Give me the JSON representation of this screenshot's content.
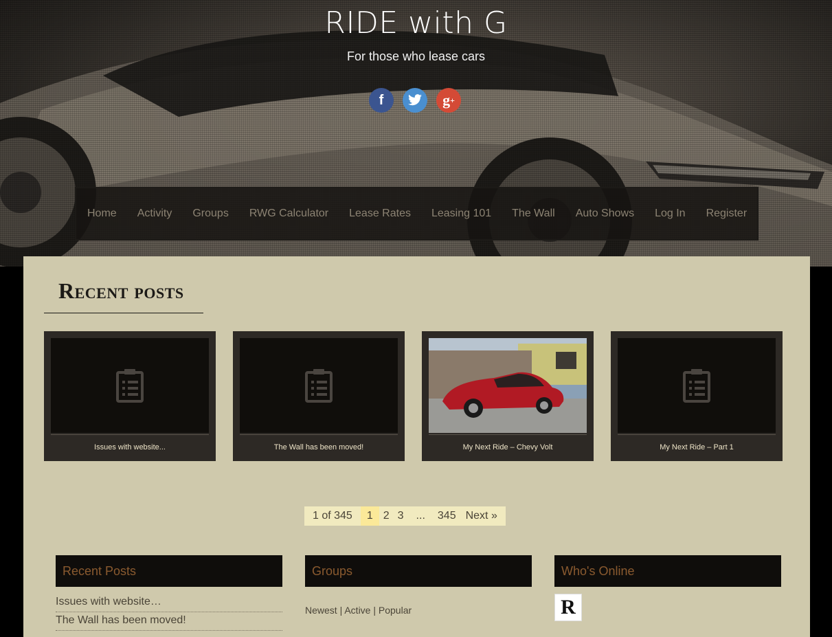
{
  "site": {
    "title": "RIDE with G",
    "tagline": "For those who lease cars"
  },
  "social": [
    {
      "icon": "facebook-icon",
      "glyph": "f",
      "color": "#3b5590"
    },
    {
      "icon": "twitter-icon",
      "color": "#4a8fd0"
    },
    {
      "icon": "google-plus-icon",
      "glyph": "g+",
      "color": "#d44a36"
    }
  ],
  "nav": {
    "items": [
      {
        "label": "Home"
      },
      {
        "label": "Activity"
      },
      {
        "label": "Groups"
      },
      {
        "label": "RWG Calculator"
      },
      {
        "label": "Lease Rates"
      },
      {
        "label": "Leasing 101"
      },
      {
        "label": "The Wall"
      },
      {
        "label": "Auto Shows"
      },
      {
        "label": "Log In"
      },
      {
        "label": "Register"
      }
    ]
  },
  "recent_section": {
    "title": "Recent posts"
  },
  "posts": [
    {
      "title": "Issues with website...",
      "thumb": "document-icon"
    },
    {
      "title": "The Wall has been moved!",
      "thumb": "document-icon"
    },
    {
      "title": "My Next Ride – Chevy Volt",
      "thumb": "red-car-photo"
    },
    {
      "title": "My Next Ride – Part 1",
      "thumb": "document-icon"
    }
  ],
  "pagination": {
    "info": "1 of 345",
    "current": "1",
    "pages": [
      "2",
      "3"
    ],
    "dots": "...",
    "last": "345",
    "next": "Next »"
  },
  "widgets": {
    "recent_posts": {
      "title": "Recent Posts",
      "items": [
        "Issues with website…",
        "The Wall has been moved!"
      ]
    },
    "groups": {
      "title": "Groups",
      "links": [
        "Newest",
        "Active",
        "Popular"
      ],
      "separator": "|"
    },
    "whos_online": {
      "title": "Who's Online",
      "avatar_letter": "R"
    }
  },
  "colors": {
    "page_background": "#cfc9ac",
    "nav_text": "#8c8373",
    "widget_heading": "#8a5a2f",
    "card_background": "#2d2925",
    "pagination_background": "#f1eabf"
  }
}
